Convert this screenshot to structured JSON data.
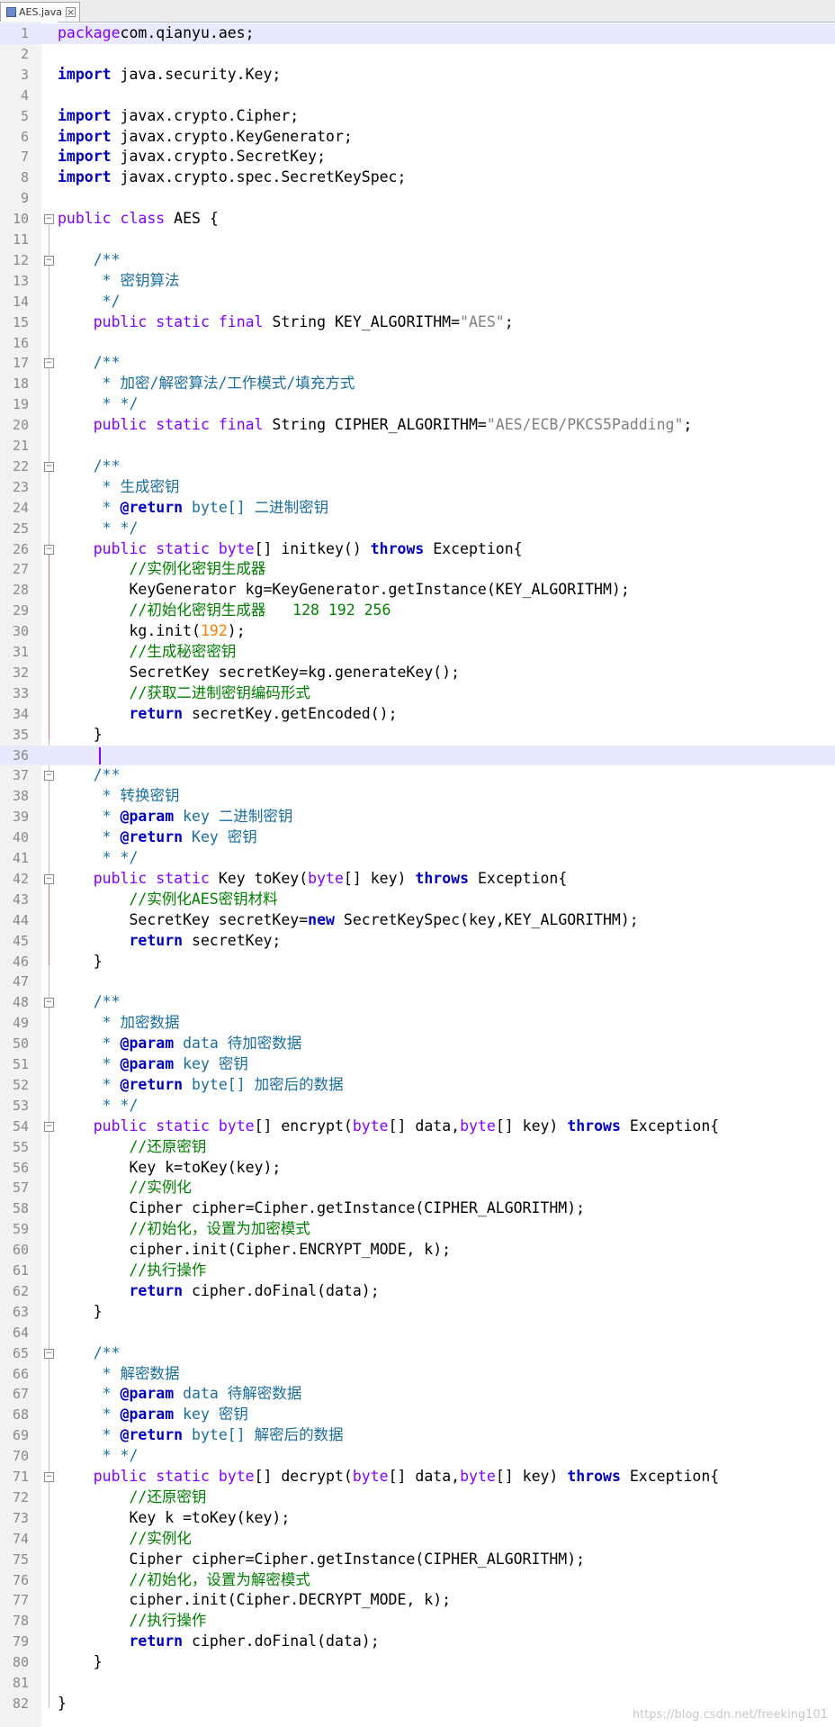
{
  "tab": {
    "label": "AES.java",
    "close": "×"
  },
  "editor": {
    "caret_line": 36,
    "lines": [
      {
        "n": "1",
        "hl": true,
        "segs": [
          [
            "kw",
            "package"
          ],
          [
            "",
            "com.qianyu.aes;"
          ]
        ]
      },
      {
        "n": "2",
        "segs": []
      },
      {
        "n": "3",
        "segs": [
          [
            "kwb",
            "import"
          ],
          [
            "",
            " java.security.Key;"
          ]
        ]
      },
      {
        "n": "4",
        "segs": []
      },
      {
        "n": "5",
        "segs": [
          [
            "kwb",
            "import"
          ],
          [
            "",
            " javax.crypto.Cipher;"
          ]
        ]
      },
      {
        "n": "6",
        "segs": [
          [
            "kwb",
            "import"
          ],
          [
            "",
            " javax.crypto.KeyGenerator;"
          ]
        ]
      },
      {
        "n": "7",
        "segs": [
          [
            "kwb",
            "import"
          ],
          [
            "",
            " javax.crypto.SecretKey;"
          ]
        ]
      },
      {
        "n": "8",
        "segs": [
          [
            "kwb",
            "import"
          ],
          [
            "",
            " javax.crypto.spec.SecretKeySpec;"
          ]
        ]
      },
      {
        "n": "9",
        "segs": []
      },
      {
        "n": "10",
        "fold": true,
        "segs": [
          [
            "kw",
            "public class"
          ],
          [
            "",
            " AES {"
          ]
        ]
      },
      {
        "n": "11",
        "segs": []
      },
      {
        "n": "12",
        "fold": true,
        "segs": [
          [
            "cmt",
            "    /**"
          ]
        ]
      },
      {
        "n": "13",
        "segs": [
          [
            "cmt",
            "     * 密钥算法"
          ]
        ]
      },
      {
        "n": "14",
        "segs": [
          [
            "cmt",
            "     */"
          ]
        ]
      },
      {
        "n": "15",
        "segs": [
          [
            "",
            "    "
          ],
          [
            "kw",
            "public static final"
          ],
          [
            "",
            " String KEY_ALGORITHM="
          ],
          [
            "str",
            "\"AES\""
          ],
          [
            "",
            ";"
          ]
        ]
      },
      {
        "n": "16",
        "segs": []
      },
      {
        "n": "17",
        "fold": true,
        "segs": [
          [
            "cmt",
            "    /**"
          ]
        ]
      },
      {
        "n": "18",
        "segs": [
          [
            "cmt",
            "     * 加密/解密算法/工作模式/填充方式"
          ]
        ]
      },
      {
        "n": "19",
        "segs": [
          [
            "cmt",
            "     * */"
          ]
        ]
      },
      {
        "n": "20",
        "segs": [
          [
            "",
            "    "
          ],
          [
            "kw",
            "public static final"
          ],
          [
            "",
            " String CIPHER_ALGORITHM="
          ],
          [
            "str",
            "\"AES/ECB/PKCS5Padding\""
          ],
          [
            "",
            ";"
          ]
        ]
      },
      {
        "n": "21",
        "segs": []
      },
      {
        "n": "22",
        "fold": true,
        "segs": [
          [
            "cmt",
            "    /**"
          ]
        ]
      },
      {
        "n": "23",
        "segs": [
          [
            "cmt",
            "     * 生成密钥"
          ]
        ]
      },
      {
        "n": "24",
        "segs": [
          [
            "cmt",
            "     * "
          ],
          [
            "kwb",
            "@return"
          ],
          [
            "cmt",
            " byte[] 二进制密钥"
          ]
        ]
      },
      {
        "n": "25",
        "segs": [
          [
            "cmt",
            "     * */"
          ]
        ]
      },
      {
        "n": "26",
        "fold": true,
        "segs": [
          [
            "",
            "    "
          ],
          [
            "kw",
            "public static byte"
          ],
          [
            "",
            "[] initkey() "
          ],
          [
            "kwb",
            "throws"
          ],
          [
            "",
            " Exception{"
          ]
        ]
      },
      {
        "n": "27",
        "segs": [
          [
            "cm",
            "        //实例化密钥生成器"
          ]
        ]
      },
      {
        "n": "28",
        "segs": [
          [
            "",
            "        KeyGenerator kg=KeyGenerator.getInstance(KEY_ALGORITHM);"
          ]
        ]
      },
      {
        "n": "29",
        "segs": [
          [
            "cm",
            "        //初始化密钥生成器   128 192 256"
          ]
        ]
      },
      {
        "n": "30",
        "segs": [
          [
            "",
            "        kg.init("
          ],
          [
            "num",
            "192"
          ],
          [
            "",
            ");"
          ]
        ]
      },
      {
        "n": "31",
        "segs": [
          [
            "cm",
            "        //生成秘密密钥"
          ]
        ]
      },
      {
        "n": "32",
        "segs": [
          [
            "",
            "        SecretKey secretKey=kg.generateKey();"
          ]
        ]
      },
      {
        "n": "33",
        "segs": [
          [
            "cm",
            "        //获取二进制密钥编码形式"
          ]
        ]
      },
      {
        "n": "34",
        "segs": [
          [
            "",
            "        "
          ],
          [
            "kwb",
            "return"
          ],
          [
            "",
            " secretKey.getEncoded();"
          ]
        ]
      },
      {
        "n": "35",
        "segs": [
          [
            "",
            "    }"
          ]
        ]
      },
      {
        "n": "36",
        "hl": true,
        "segs": []
      },
      {
        "n": "37",
        "fold": true,
        "segs": [
          [
            "cmt",
            "    /**"
          ]
        ]
      },
      {
        "n": "38",
        "segs": [
          [
            "cmt",
            "     * 转换密钥"
          ]
        ]
      },
      {
        "n": "39",
        "segs": [
          [
            "cmt",
            "     * "
          ],
          [
            "kwb",
            "@param"
          ],
          [
            "cmt",
            " key 二进制密钥"
          ]
        ]
      },
      {
        "n": "40",
        "segs": [
          [
            "cmt",
            "     * "
          ],
          [
            "kwb",
            "@return"
          ],
          [
            "cmt",
            " Key 密钥"
          ]
        ]
      },
      {
        "n": "41",
        "segs": [
          [
            "cmt",
            "     * */"
          ]
        ]
      },
      {
        "n": "42",
        "fold": true,
        "segs": [
          [
            "",
            "    "
          ],
          [
            "kw",
            "public static"
          ],
          [
            "",
            " Key toKey("
          ],
          [
            "kw",
            "byte"
          ],
          [
            "",
            "[] key) "
          ],
          [
            "kwb",
            "throws"
          ],
          [
            "",
            " Exception{"
          ]
        ]
      },
      {
        "n": "43",
        "segs": [
          [
            "cm",
            "        //实例化AES密钥材料"
          ]
        ]
      },
      {
        "n": "44",
        "segs": [
          [
            "",
            "        SecretKey secretKey="
          ],
          [
            "kwb",
            "new"
          ],
          [
            "",
            " SecretKeySpec(key,KEY_ALGORITHM);"
          ]
        ]
      },
      {
        "n": "45",
        "segs": [
          [
            "",
            "        "
          ],
          [
            "kwb",
            "return"
          ],
          [
            "",
            " secretKey;"
          ]
        ]
      },
      {
        "n": "46",
        "segs": [
          [
            "",
            "    }"
          ]
        ]
      },
      {
        "n": "47",
        "segs": []
      },
      {
        "n": "48",
        "fold": true,
        "segs": [
          [
            "cmt",
            "    /**"
          ]
        ]
      },
      {
        "n": "49",
        "segs": [
          [
            "cmt",
            "     * 加密数据"
          ]
        ]
      },
      {
        "n": "50",
        "segs": [
          [
            "cmt",
            "     * "
          ],
          [
            "kwb",
            "@param"
          ],
          [
            "cmt",
            " data 待加密数据"
          ]
        ]
      },
      {
        "n": "51",
        "segs": [
          [
            "cmt",
            "     * "
          ],
          [
            "kwb",
            "@param"
          ],
          [
            "cmt",
            " key 密钥"
          ]
        ]
      },
      {
        "n": "52",
        "segs": [
          [
            "cmt",
            "     * "
          ],
          [
            "kwb",
            "@return"
          ],
          [
            "cmt",
            " byte[] 加密后的数据"
          ]
        ]
      },
      {
        "n": "53",
        "segs": [
          [
            "cmt",
            "     * */"
          ]
        ]
      },
      {
        "n": "54",
        "fold": true,
        "segs": [
          [
            "",
            "    "
          ],
          [
            "kw",
            "public static byte"
          ],
          [
            "",
            "[] encrypt("
          ],
          [
            "kw",
            "byte"
          ],
          [
            "",
            "[] data,"
          ],
          [
            "kw",
            "byte"
          ],
          [
            "",
            "[] key) "
          ],
          [
            "kwb",
            "throws"
          ],
          [
            "",
            " Exception{"
          ]
        ]
      },
      {
        "n": "55",
        "segs": [
          [
            "cm",
            "        //还原密钥"
          ]
        ]
      },
      {
        "n": "56",
        "segs": [
          [
            "",
            "        Key k=toKey(key);"
          ]
        ]
      },
      {
        "n": "57",
        "segs": [
          [
            "cm",
            "        //实例化"
          ]
        ]
      },
      {
        "n": "58",
        "segs": [
          [
            "",
            "        Cipher cipher=Cipher.getInstance(CIPHER_ALGORITHM);"
          ]
        ]
      },
      {
        "n": "59",
        "segs": [
          [
            "cm",
            "        //初始化，设置为加密模式"
          ]
        ]
      },
      {
        "n": "60",
        "segs": [
          [
            "",
            "        cipher.init(Cipher.ENCRYPT_MODE, k);"
          ]
        ]
      },
      {
        "n": "61",
        "segs": [
          [
            "cm",
            "        //执行操作"
          ]
        ]
      },
      {
        "n": "62",
        "segs": [
          [
            "",
            "        "
          ],
          [
            "kwb",
            "return"
          ],
          [
            "",
            " cipher.doFinal(data);"
          ]
        ]
      },
      {
        "n": "63",
        "segs": [
          [
            "",
            "    }"
          ]
        ]
      },
      {
        "n": "64",
        "segs": []
      },
      {
        "n": "65",
        "fold": true,
        "segs": [
          [
            "cmt",
            "    /**"
          ]
        ]
      },
      {
        "n": "66",
        "segs": [
          [
            "cmt",
            "     * 解密数据"
          ]
        ]
      },
      {
        "n": "67",
        "segs": [
          [
            "cmt",
            "     * "
          ],
          [
            "kwb",
            "@param"
          ],
          [
            "cmt",
            " data 待解密数据"
          ]
        ]
      },
      {
        "n": "68",
        "segs": [
          [
            "cmt",
            "     * "
          ],
          [
            "kwb",
            "@param"
          ],
          [
            "cmt",
            " key 密钥"
          ]
        ]
      },
      {
        "n": "69",
        "segs": [
          [
            "cmt",
            "     * "
          ],
          [
            "kwb",
            "@return"
          ],
          [
            "cmt",
            " byte[] 解密后的数据"
          ]
        ]
      },
      {
        "n": "70",
        "segs": [
          [
            "cmt",
            "     * */"
          ]
        ]
      },
      {
        "n": "71",
        "fold": true,
        "segs": [
          [
            "",
            "    "
          ],
          [
            "kw",
            "public static byte"
          ],
          [
            "",
            "[] decrypt("
          ],
          [
            "kw",
            "byte"
          ],
          [
            "",
            "[] data,"
          ],
          [
            "kw",
            "byte"
          ],
          [
            "",
            "[] key) "
          ],
          [
            "kwb",
            "throws"
          ],
          [
            "",
            " Exception{"
          ]
        ]
      },
      {
        "n": "72",
        "segs": [
          [
            "cm",
            "        //还原密钥"
          ]
        ]
      },
      {
        "n": "73",
        "segs": [
          [
            "",
            "        Key k =toKey(key);"
          ]
        ]
      },
      {
        "n": "74",
        "segs": [
          [
            "cm",
            "        //实例化"
          ]
        ]
      },
      {
        "n": "75",
        "segs": [
          [
            "",
            "        Cipher cipher=Cipher.getInstance(CIPHER_ALGORITHM);"
          ]
        ]
      },
      {
        "n": "76",
        "segs": [
          [
            "cm",
            "        //初始化，设置为解密模式"
          ]
        ]
      },
      {
        "n": "77",
        "segs": [
          [
            "",
            "        cipher.init(Cipher.DECRYPT_MODE, k);"
          ]
        ]
      },
      {
        "n": "78",
        "segs": [
          [
            "cm",
            "        //执行操作"
          ]
        ]
      },
      {
        "n": "79",
        "segs": [
          [
            "",
            "        "
          ],
          [
            "kwb",
            "return"
          ],
          [
            "",
            " cipher.doFinal(data);"
          ]
        ]
      },
      {
        "n": "80",
        "segs": [
          [
            "",
            "    }"
          ]
        ]
      },
      {
        "n": "81",
        "segs": []
      },
      {
        "n": "82",
        "segs": [
          [
            "",
            "}"
          ]
        ]
      }
    ]
  },
  "watermark": "https://blog.csdn.net/freeking101"
}
